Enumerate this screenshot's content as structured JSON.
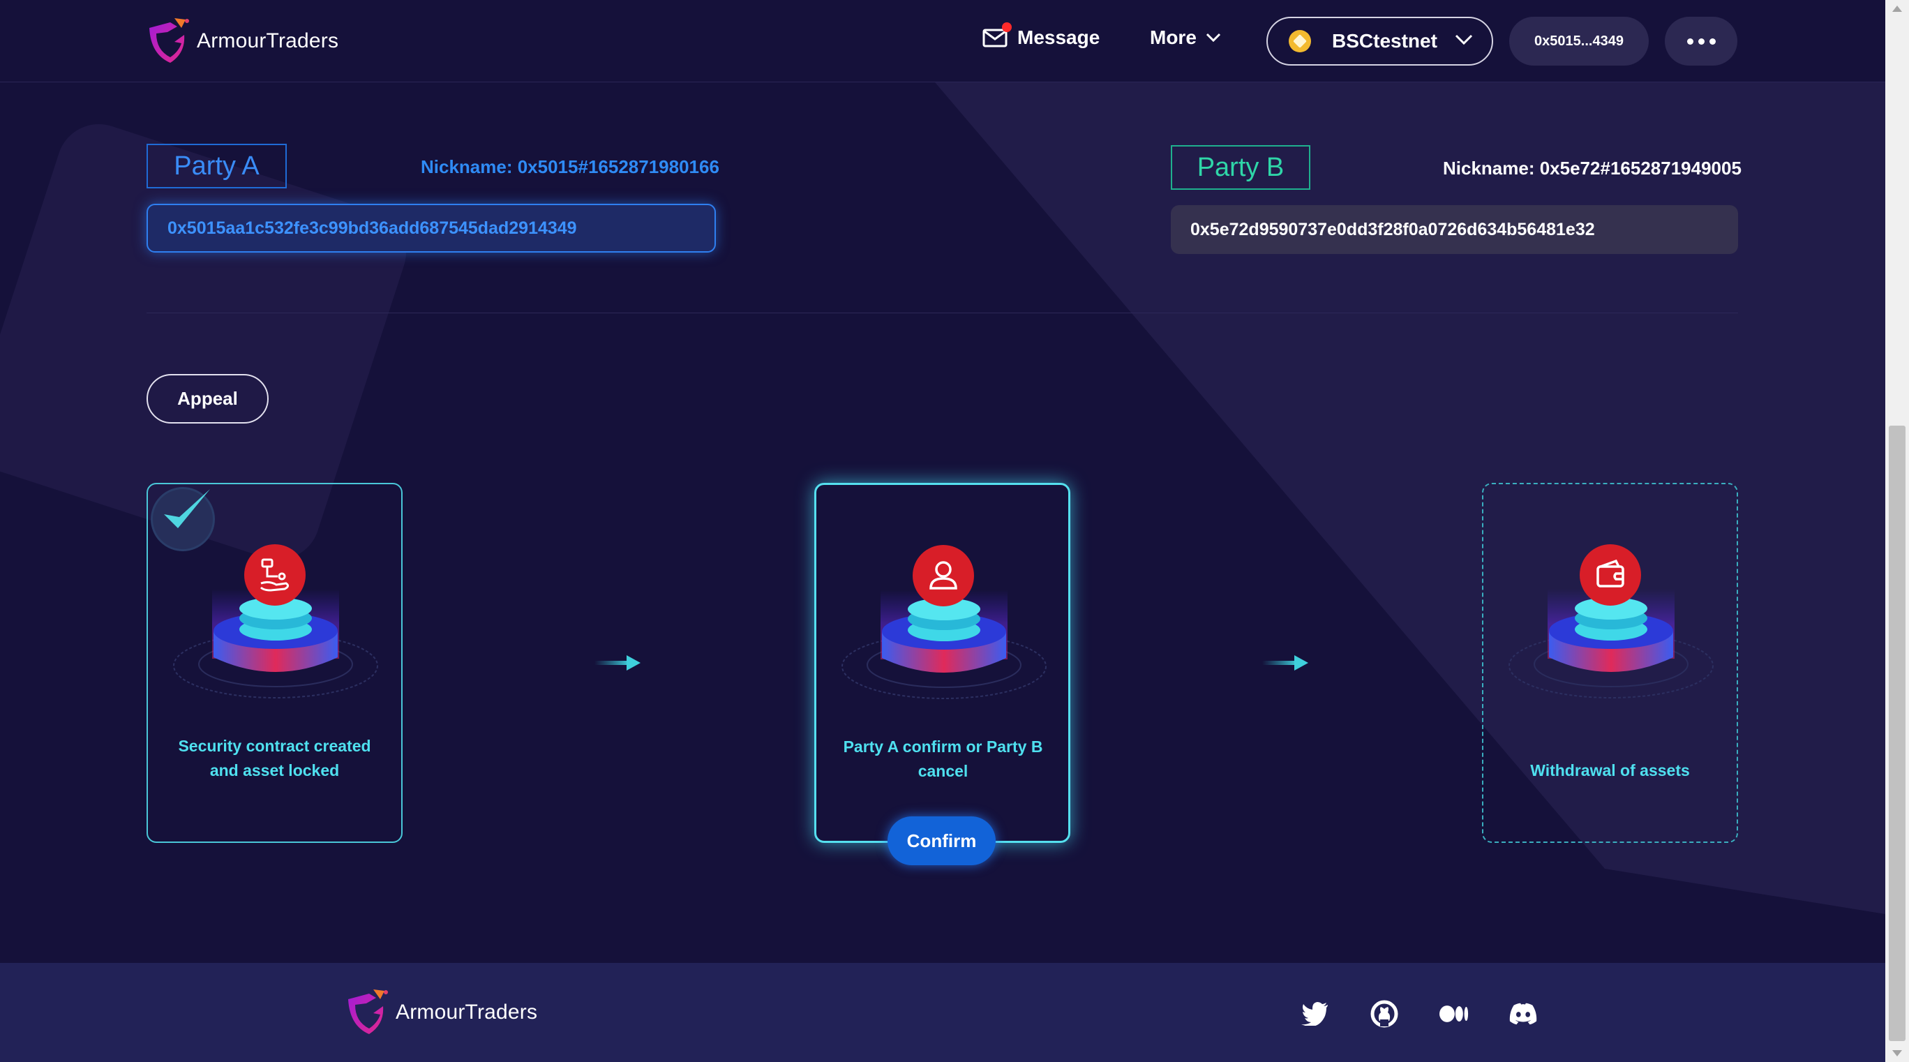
{
  "header": {
    "brand": "ArmourTraders",
    "message_label": "Message",
    "more_label": "More",
    "network": "BSCtestnet",
    "wallet_address": "0x5015...4349"
  },
  "party_a": {
    "tag": "Party A",
    "nickname": "Nickname: 0x5015#1652871980166",
    "address": "0x5015aa1c532fe3c99bd36add687545dad2914349"
  },
  "party_b": {
    "tag": "Party B",
    "nickname": "Nickname: 0x5e72#1652871949005",
    "address": "0x5e72d9590737e0dd3f28f0a0726d634b56481e32"
  },
  "appeal_label": "Appeal",
  "steps": [
    {
      "label_line1": "Security contract created",
      "label_line2": "and asset locked",
      "icon": "contract-hand-icon",
      "status": "completed"
    },
    {
      "label_line1": "Party A confirm or Party B",
      "label_line2": "cancel",
      "icon": "user-icon",
      "status": "active"
    },
    {
      "label_line1": "",
      "label_line2": "Withdrawal of assets",
      "icon": "wallet-icon",
      "status": "pending"
    }
  ],
  "confirm_label": "Confirm",
  "footer": {
    "brand": "ArmourTraders",
    "social": [
      "twitter-icon",
      "github-icon",
      "medium-icon",
      "discord-icon"
    ]
  },
  "colors": {
    "background": "#15113a",
    "accent_blue": "#2f8bf5",
    "accent_green": "#2fd6a8",
    "accent_cyan": "#4fe0ef",
    "icon_red": "#d81e28",
    "footer": "#222257"
  }
}
